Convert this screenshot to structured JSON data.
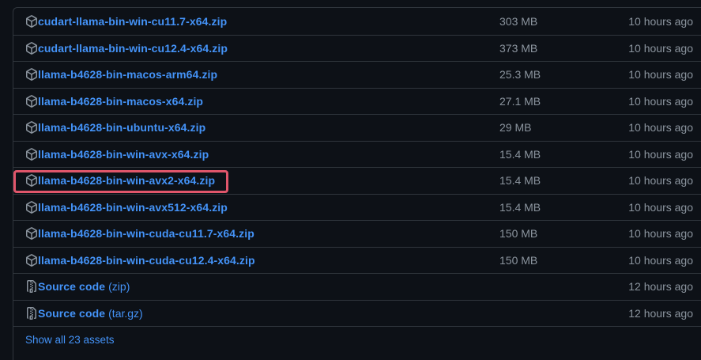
{
  "colors": {
    "background": "#0d1117",
    "border": "#30363d",
    "link": "#4493f8",
    "muted": "#8b949e",
    "highlight": "#e0566b"
  },
  "assets": [
    {
      "name": "cudart-llama-bin-win-cu11.7-x64.zip",
      "icon": "package-icon",
      "size": "303 MB",
      "time": "10 hours ago",
      "highlighted": false
    },
    {
      "name": "cudart-llama-bin-win-cu12.4-x64.zip",
      "icon": "package-icon",
      "size": "373 MB",
      "time": "10 hours ago",
      "highlighted": false
    },
    {
      "name": "llama-b4628-bin-macos-arm64.zip",
      "icon": "package-icon",
      "size": "25.3 MB",
      "time": "10 hours ago",
      "highlighted": false
    },
    {
      "name": "llama-b4628-bin-macos-x64.zip",
      "icon": "package-icon",
      "size": "27.1 MB",
      "time": "10 hours ago",
      "highlighted": false
    },
    {
      "name": "llama-b4628-bin-ubuntu-x64.zip",
      "icon": "package-icon",
      "size": "29 MB",
      "time": "10 hours ago",
      "highlighted": false
    },
    {
      "name": "llama-b4628-bin-win-avx-x64.zip",
      "icon": "package-icon",
      "size": "15.4 MB",
      "time": "10 hours ago",
      "highlighted": false
    },
    {
      "name": "llama-b4628-bin-win-avx2-x64.zip",
      "icon": "package-icon",
      "size": "15.4 MB",
      "time": "10 hours ago",
      "highlighted": true
    },
    {
      "name": "llama-b4628-bin-win-avx512-x64.zip",
      "icon": "package-icon",
      "size": "15.4 MB",
      "time": "10 hours ago",
      "highlighted": false
    },
    {
      "name": "llama-b4628-bin-win-cuda-cu11.7-x64.zip",
      "icon": "package-icon",
      "size": "150 MB",
      "time": "10 hours ago",
      "highlighted": false
    },
    {
      "name": "llama-b4628-bin-win-cuda-cu12.4-x64.zip",
      "icon": "package-icon",
      "size": "150 MB",
      "time": "10 hours ago",
      "highlighted": false
    }
  ],
  "source_code": [
    {
      "name": "Source code",
      "suffix": "(zip)",
      "icon": "file-zip-icon",
      "time": "12 hours ago"
    },
    {
      "name": "Source code",
      "suffix": "(tar.gz)",
      "icon": "file-zip-icon",
      "time": "12 hours ago"
    }
  ],
  "show_all_label": "Show all 23 assets"
}
